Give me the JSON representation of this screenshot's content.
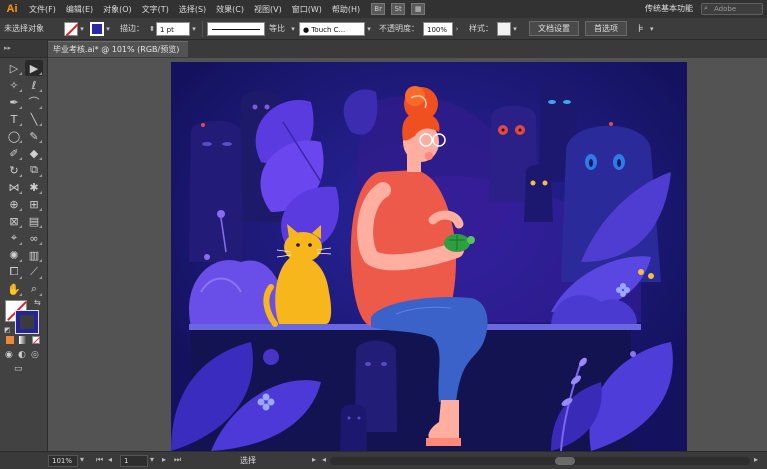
{
  "app": {
    "logo": "Ai",
    "workspace": "传统基本功能",
    "search_placeholder": "Adobe"
  },
  "menu": [
    "文件(F)",
    "编辑(E)",
    "对象(O)",
    "文字(T)",
    "选择(S)",
    "效果(C)",
    "视图(V)",
    "窗口(W)",
    "帮助(H)"
  ],
  "menu_icons": [
    "Br",
    "St"
  ],
  "control": {
    "selection_label": "未选择对象",
    "stroke_label": "描边：",
    "stroke_weight": "1 pt",
    "stroke_profile": "等比",
    "brush_name": "Touch C...",
    "opacity_label": "不透明度：",
    "opacity_value": "100%",
    "style_label": "样式：",
    "doc_settings_button": "文档设置",
    "preferences_button": "首选项"
  },
  "document": {
    "tab_title": "毕业考核.ai* @ 101% (RGB/预览)",
    "close_glyph": "×"
  },
  "status": {
    "zoom": "101%",
    "page": "1",
    "tool": "选择"
  },
  "colors": {
    "artboard_bg": "#17166b",
    "hair": "#f05020",
    "shirt": "#ee5a4a",
    "jeans": "#3a62c8",
    "cat": "#f6b61c",
    "skin": "#ffaea0",
    "turtle": "#2e9e40"
  }
}
